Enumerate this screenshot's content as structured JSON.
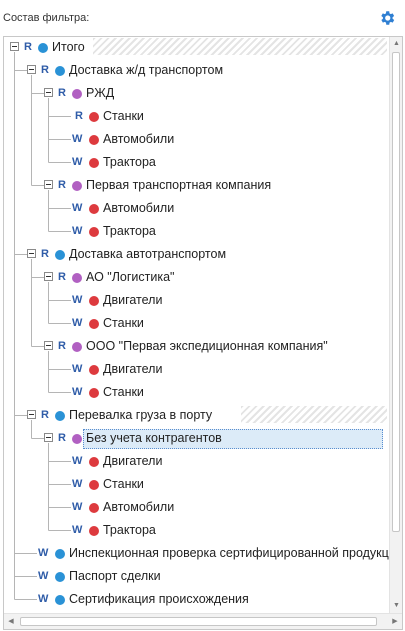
{
  "panel": {
    "title": "Состав фильтра:",
    "settings_icon": "gear-icon",
    "accent_color": "#2f7fd2"
  },
  "tree": [
    {
      "label": "Итого",
      "badge": "R",
      "color": "blue",
      "expanded": true,
      "hatched": true,
      "children": [
        {
          "label": "Доставка ж/д транспортом",
          "badge": "R",
          "color": "blue",
          "expanded": true,
          "children": [
            {
              "label": "РЖД",
              "badge": "R",
              "color": "purple",
              "expanded": true,
              "children": [
                {
                  "label": "Станки",
                  "badge": "R",
                  "color": "red"
                },
                {
                  "label": "Автомобили",
                  "badge": "W",
                  "color": "red"
                },
                {
                  "label": "Трактора",
                  "badge": "W",
                  "color": "red"
                }
              ]
            },
            {
              "label": "Первая транспортная компания",
              "badge": "R",
              "color": "purple",
              "expanded": true,
              "children": [
                {
                  "label": "Автомобили",
                  "badge": "W",
                  "color": "red"
                },
                {
                  "label": "Трактора",
                  "badge": "W",
                  "color": "red"
                }
              ]
            }
          ]
        },
        {
          "label": "Доставка автотранспортом",
          "badge": "R",
          "color": "blue",
          "expanded": true,
          "children": [
            {
              "label": "АО \"Логистика\"",
              "badge": "R",
              "color": "purple",
              "expanded": true,
              "children": [
                {
                  "label": "Двигатели",
                  "badge": "W",
                  "color": "red"
                },
                {
                  "label": "Станки",
                  "badge": "W",
                  "color": "red"
                }
              ]
            },
            {
              "label": "ООО \"Первая экспедиционная компания\"",
              "badge": "R",
              "color": "purple",
              "expanded": true,
              "children": [
                {
                  "label": "Двигатели",
                  "badge": "W",
                  "color": "red"
                },
                {
                  "label": "Станки",
                  "badge": "W",
                  "color": "red"
                }
              ]
            }
          ]
        },
        {
          "label": "Перевалка груза в порту",
          "badge": "R",
          "color": "blue",
          "expanded": true,
          "hatched": true,
          "children": [
            {
              "label": "Без учета контрагентов",
              "badge": "R",
              "color": "purple",
              "expanded": true,
              "selected": true,
              "children": [
                {
                  "label": "Двигатели",
                  "badge": "W",
                  "color": "red"
                },
                {
                  "label": "Станки",
                  "badge": "W",
                  "color": "red"
                },
                {
                  "label": "Автомобили",
                  "badge": "W",
                  "color": "red"
                },
                {
                  "label": "Трактора",
                  "badge": "W",
                  "color": "red"
                }
              ]
            }
          ]
        },
        {
          "label": "Инспекционная проверка сертифицированной продукции",
          "badge": "W",
          "color": "blue"
        },
        {
          "label": "Паспорт сделки",
          "badge": "W",
          "color": "blue"
        },
        {
          "label": "Сертификация происхождения",
          "badge": "W",
          "color": "blue"
        }
      ]
    }
  ]
}
